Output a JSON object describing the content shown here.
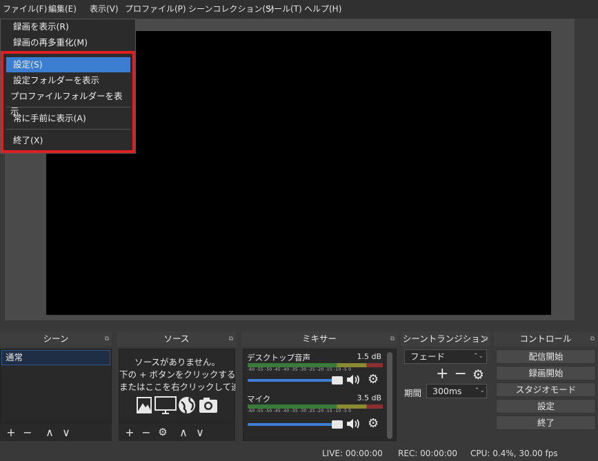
{
  "menubar": {
    "items": [
      "ファイル(F)",
      "編集(E)",
      "表示(V)",
      "プロファイル(P)",
      "シーンコレクション(S)",
      "ツール(T)",
      "ヘルプ(H)"
    ]
  },
  "file_menu": {
    "items": [
      "録画を表示(R)",
      "録画の再多重化(M)",
      "設定(S)",
      "設定フォルダーを表示",
      "プロファイルフォルダーを表示",
      "常に手前に表示(A)",
      "終了(X)"
    ],
    "selected": "設定(S)"
  },
  "highlight_color": "#e02020",
  "panels": {
    "scenes": {
      "title": "シーン",
      "items": [
        "通常"
      ]
    },
    "sources": {
      "title": "ソース",
      "empty_line1": "ソースがありません。",
      "empty_line2": "下の + ボタンをクリックするか、",
      "empty_line3": "またはここを右クリックして追加してください。"
    },
    "mixer": {
      "title": "ミキサー",
      "channels": [
        {
          "name": "デスクトップ音声",
          "db": "1.5 dB"
        },
        {
          "name": "マイク",
          "db": "3.5 dB"
        }
      ],
      "ticks": "-60 -55 -50 -45 -40 -35 -30 -25 -20 -15 -10 -5 0"
    },
    "transitions": {
      "title": "シーントランジション",
      "type": "フェード",
      "duration_label": "期間",
      "duration": "300ms"
    },
    "controls": {
      "title": "コントロール",
      "buttons": [
        "配信開始",
        "録画開始",
        "スタジオモード",
        "設定",
        "終了"
      ]
    }
  },
  "icons": {
    "add": "+",
    "remove": "−",
    "up": "∧",
    "down": "∨",
    "gear": "⚙",
    "speaker": "🔊",
    "pin": "⧉"
  },
  "status": {
    "live": "LIVE: 00:00:00",
    "rec": "REC: 00:00:00",
    "cpu": "CPU: 0.4%, 30.00 fps"
  }
}
